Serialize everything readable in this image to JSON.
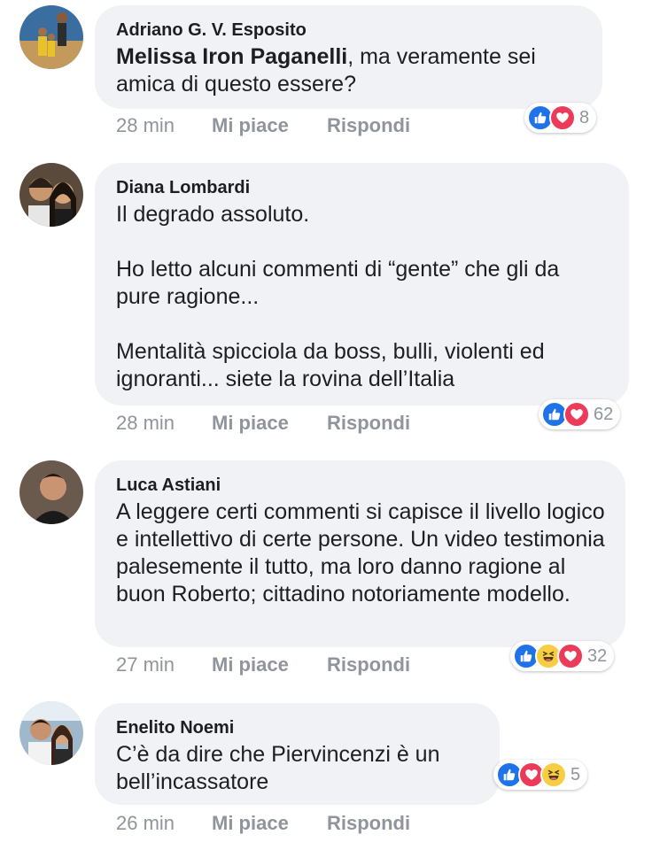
{
  "comments": [
    {
      "author": "Adriano G. V. Esposito",
      "mention": "Melissa Iron Paganelli",
      "text_after_mention": ", ma veramente sei amica di questo essere?",
      "time": "28 min",
      "like_label": "Mi piace",
      "reply_label": "Rispondi",
      "reactions": [
        "like-icon",
        "love-icon"
      ],
      "reaction_count": "8"
    },
    {
      "author": "Diana Lombardi",
      "paragraphs": [
        "Il degrado assoluto.",
        "Ho letto alcuni commenti di “gente” che gli da pure ragione...",
        "Mentalità spicciola da boss, bulli, violenti ed ignoranti... siete la rovina dell’Italia"
      ],
      "time": "28 min",
      "like_label": "Mi piace",
      "reply_label": "Rispondi",
      "reactions": [
        "like-icon",
        "love-icon"
      ],
      "reaction_count": "62"
    },
    {
      "author": "Luca Astiani",
      "text": "A leggere certi commenti si capisce il livello logico e intellettivo di certe persone. Un video testimonia palesemente il tutto, ma loro danno ragione al buon Roberto; cittadino notoriamente modello.",
      "time": "27 min",
      "like_label": "Mi piace",
      "reply_label": "Rispondi",
      "reactions": [
        "like-icon",
        "haha-icon",
        "love-icon"
      ],
      "reaction_count": "32"
    },
    {
      "author": "Enelito Noemi",
      "text": "C’è da dire che Piervincenzi è un bell’incassatore",
      "time": "26 min",
      "like_label": "Mi piace",
      "reply_label": "Rispondi",
      "reactions": [
        "like-icon",
        "love-icon",
        "haha-icon"
      ],
      "reaction_count": "5"
    }
  ],
  "colors": {
    "bubble": "#f1f2f5",
    "text": "#1c1e21",
    "meta": "#90949c",
    "like": "#1f73e8",
    "love": "#ec3b59",
    "haha": "#f6cd43"
  }
}
